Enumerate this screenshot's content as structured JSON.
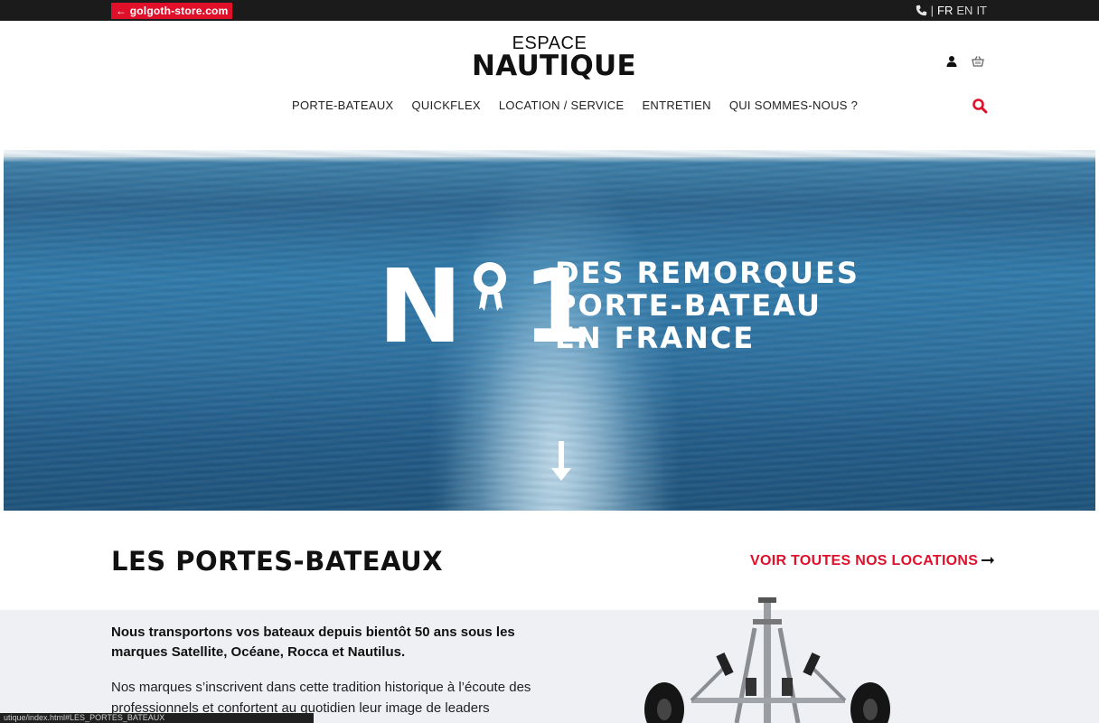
{
  "topbar": {
    "store_link": "← golgoth-store.com",
    "languages": [
      "FR",
      "EN",
      "IT"
    ],
    "separator": "|"
  },
  "header": {
    "logo_line1": "ESPACE",
    "logo_line2": "NAUTIQUE",
    "icons": [
      "user-icon",
      "basket-icon",
      "search-icon",
      "phone-icon"
    ],
    "nav": [
      "PORTE-BATEAUX",
      "QUICKFLEX",
      "LOCATION / SERVICE",
      "ENTRETIEN",
      "QUI SOMMES-NOUS ?"
    ]
  },
  "hero": {
    "badge_letter": "N",
    "badge_number": "1",
    "lines": [
      "DES REMORQUES",
      "PORTE-BATEAU",
      "EN FRANCE"
    ]
  },
  "section": {
    "title": "LES PORTES-BATEAUX",
    "see_all": "VOIR TOUTES NOS LOCATIONS",
    "lead": "Nous transportons vos bateaux depuis bientôt 50 ans sous les marques Satellite, Océane, Rocca et Nautilus.",
    "body": "Nos marques s’inscrivent dans cette tradition historique à l’écoute des professionnels et confortent au quotidien leur image de leaders"
  },
  "statusbar": {
    "url": "utique/index.html#LES_PORTES_BATEAUX"
  },
  "colors": {
    "accent": "#e0102b",
    "topbar": "#1b1b1b",
    "content_bg": "#eef0f3"
  }
}
